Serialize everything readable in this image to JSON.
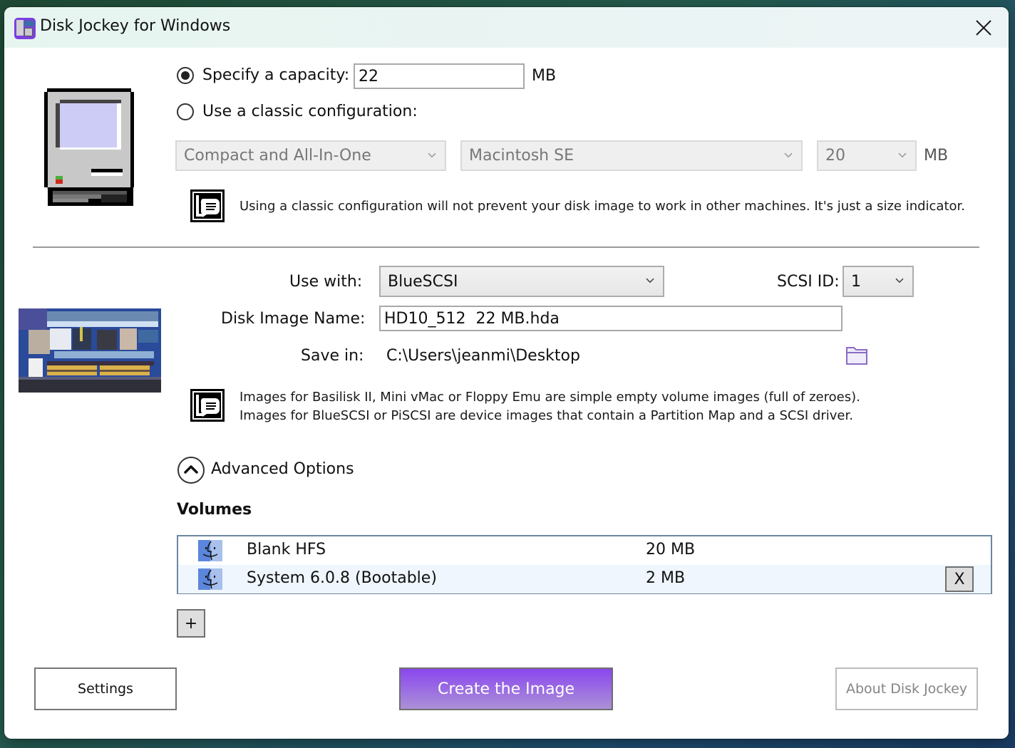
{
  "window": {
    "title": "Disk Jockey for Windows",
    "close_icon": "close-icon"
  },
  "capacity": {
    "specify_label": "Specify a capacity:",
    "specify_selected": true,
    "capacity_value": "22",
    "capacity_unit": "MB",
    "classic_label": "Use a classic configuration:",
    "classic_selected": false,
    "category_select": "Compact and All-In-One",
    "model_select": "Macintosh SE",
    "size_select": "20",
    "size_unit": "MB",
    "note": "Using a classic configuration will not prevent your disk image to work in other machines. It's just a size indicator."
  },
  "target": {
    "use_with_label": "Use with:",
    "use_with_value": "BlueSCSI",
    "scsi_id_label": "SCSI ID:",
    "scsi_id_value": "1",
    "image_name_label": "Disk Image Name:",
    "image_name_value": "HD10_512  22 MB.hda",
    "save_in_label": "Save in:",
    "save_in_value": "C:\\Users\\jeanmi\\Desktop",
    "note_line1": "Images for Basilisk II, Mini vMac or Floppy Emu are simple empty volume images (full of zeroes).",
    "note_line2": "Images for BlueSCSI or PiSCSI are device images that contain a Partition Map and a SCSI driver."
  },
  "advanced": {
    "toggle_label": "Advanced Options",
    "expanded": true,
    "volumes_heading": "Volumes",
    "volumes": [
      {
        "name": "Blank HFS",
        "size": "20 MB",
        "removable": false
      },
      {
        "name": "System 6.0.8 (Bootable)",
        "size": "2 MB",
        "removable": true
      }
    ],
    "remove_label": "X",
    "add_label": "+"
  },
  "footer": {
    "settings_label": "Settings",
    "create_label": "Create the Image",
    "about_label": "About Disk Jockey"
  },
  "colors": {
    "accent_top": "#8a47ef",
    "accent_bottom": "#ab90d6",
    "folder_icon": "#8a6cc4",
    "list_border": "#6d86a3"
  }
}
